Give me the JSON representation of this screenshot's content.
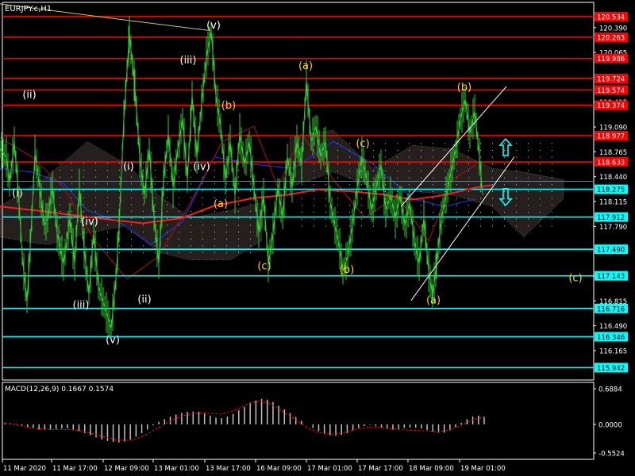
{
  "title": "EURJPY.c,H1",
  "chart_data": [
    {
      "type": "line",
      "name": "price",
      "title": "EURJPY.c,H1",
      "ylim": [
        115.78,
        120.72
      ],
      "x_labels": [
        "11 Mar 2020",
        "11 Mar 17:00",
        "12 Mar 09:00",
        "13 Mar 01:00",
        "13 Mar 17:00",
        "16 Mar 09:00",
        "17 Mar 01:00",
        "17 Mar 17:00",
        "18 Mar 09:00",
        "19 Mar 01:00"
      ],
      "y_ticks": [
        120.39,
        120.065,
        119.74,
        119.415,
        119.09,
        118.765,
        118.44,
        118.115,
        117.79,
        117.465,
        117.14,
        116.815,
        116.49,
        116.165
      ],
      "price_path": [
        [
          0,
          118.8
        ],
        [
          8,
          118.7
        ],
        [
          12,
          118.35
        ],
        [
          18,
          118.9
        ],
        [
          24,
          118.1
        ],
        [
          28,
          117.4
        ],
        [
          34,
          116.8
        ],
        [
          40,
          117.9
        ],
        [
          44,
          118.75
        ],
        [
          50,
          118.3
        ],
        [
          56,
          117.8
        ],
        [
          60,
          117.9
        ],
        [
          66,
          118.3
        ],
        [
          72,
          117.7
        ],
        [
          80,
          117.3
        ],
        [
          88,
          117.9
        ],
        [
          94,
          117.3
        ],
        [
          100,
          118.3
        ],
        [
          106,
          117.5
        ],
        [
          112,
          116.9
        ],
        [
          118,
          117.7
        ],
        [
          124,
          117.0
        ],
        [
          130,
          116.8
        ],
        [
          136,
          116.6
        ],
        [
          140,
          116.45
        ],
        [
          146,
          117.1
        ],
        [
          150,
          117.8
        ],
        [
          156,
          119.2
        ],
        [
          163,
          120.3
        ],
        [
          170,
          119.6
        ],
        [
          176,
          118.7
        ],
        [
          182,
          118.2
        ],
        [
          188,
          118.8
        ],
        [
          194,
          117.9
        ],
        [
          200,
          117.3
        ],
        [
          206,
          118.4
        ],
        [
          212,
          119.0
        ],
        [
          218,
          118.3
        ],
        [
          224,
          118.8
        ],
        [
          230,
          119.2
        ],
        [
          236,
          118.4
        ],
        [
          242,
          119.5
        ],
        [
          248,
          118.7
        ],
        [
          254,
          119.4
        ],
        [
          260,
          120.0
        ],
        [
          266,
          120.35
        ],
        [
          272,
          119.5
        ],
        [
          278,
          119.1
        ],
        [
          284,
          118.4
        ],
        [
          290,
          118.9
        ],
        [
          296,
          118.2
        ],
        [
          302,
          119.0
        ],
        [
          308,
          118.6
        ],
        [
          314,
          118.9
        ],
        [
          320,
          118.3
        ],
        [
          326,
          117.7
        ],
        [
          332,
          118.2
        ],
        [
          338,
          117.3
        ],
        [
          344,
          117.7
        ],
        [
          350,
          118.3
        ],
        [
          356,
          117.9
        ],
        [
          362,
          118.7
        ],
        [
          368,
          118.3
        ],
        [
          374,
          118.9
        ],
        [
          380,
          118.6
        ],
        [
          386,
          119.7
        ],
        [
          392,
          118.9
        ],
        [
          398,
          119.1
        ],
        [
          404,
          118.7
        ],
        [
          410,
          118.9
        ],
        [
          416,
          118.1
        ],
        [
          422,
          117.8
        ],
        [
          428,
          117.5
        ],
        [
          432,
          117.2
        ],
        [
          438,
          117.4
        ],
        [
          444,
          117.8
        ],
        [
          450,
          118.3
        ],
        [
          456,
          118.7
        ],
        [
          462,
          118.4
        ],
        [
          468,
          118.0
        ],
        [
          474,
          118.3
        ],
        [
          480,
          118.6
        ],
        [
          486,
          118.0
        ],
        [
          492,
          118.2
        ],
        [
          498,
          117.9
        ],
        [
          504,
          118.2
        ],
        [
          510,
          117.8
        ],
        [
          516,
          118.1
        ],
        [
          522,
          117.6
        ],
        [
          528,
          117.3
        ],
        [
          534,
          117.9
        ],
        [
          540,
          117.2
        ],
        [
          545,
          116.88
        ],
        [
          550,
          117.3
        ],
        [
          556,
          117.9
        ],
        [
          562,
          118.2
        ],
        [
          568,
          118.5
        ],
        [
          574,
          118.8
        ],
        [
          580,
          119.2
        ],
        [
          586,
          119.45
        ],
        [
          592,
          119.0
        ],
        [
          598,
          119.3
        ],
        [
          604,
          118.7
        ],
        [
          608,
          118.2
        ]
      ],
      "levels_red": [
        120.534,
        120.263,
        119.986,
        119.724,
        119.574,
        119.374,
        118.977,
        118.633
      ],
      "levels_cyan": [
        118.275,
        117.912,
        117.49,
        117.143,
        116.716,
        116.346,
        115.942
      ],
      "price_current": 118.38,
      "wave_labels": [
        {
          "x": 37,
          "y": 119.47,
          "text": "(ii)",
          "color": "#FFFFFF"
        },
        {
          "x": 22,
          "y": 118.18,
          "text": "(i)",
          "color": "#FFFFFF"
        },
        {
          "x": 113,
          "y": 117.81,
          "text": "(iv)",
          "color": "#FFFFFF"
        },
        {
          "x": 102,
          "y": 116.72,
          "text": "(iii)",
          "color": "#FFFFFF"
        },
        {
          "x": 182,
          "y": 116.79,
          "text": "(ii)",
          "color": "#FFFFFF"
        },
        {
          "x": 142,
          "y": 116.26,
          "text": "(v)",
          "color": "#FFFFFF"
        },
        {
          "x": 162,
          "y": 118.53,
          "text": "(i)",
          "color": "#FFFFFF"
        },
        {
          "x": 237,
          "y": 119.92,
          "text": "(iii)",
          "color": "#FFFFFF"
        },
        {
          "x": 254,
          "y": 118.53,
          "text": "(iv)",
          "color": "#FFFFFF"
        },
        {
          "x": 269,
          "y": 120.38,
          "text": "(v)",
          "color": "#FFFFFF"
        },
        {
          "x": 288,
          "y": 119.33,
          "text": "(b)",
          "color": "#FFD700"
        },
        {
          "x": 278,
          "y": 118.04,
          "text": "(a)",
          "color": "#FFD700"
        },
        {
          "x": 333,
          "y": 117.23,
          "text": "(c)",
          "color": "#FFD700"
        },
        {
          "x": 385,
          "y": 119.85,
          "text": "(a)",
          "color": "#FFD700"
        },
        {
          "x": 437,
          "y": 117.18,
          "text": "(b)",
          "color": "#FFD700"
        },
        {
          "x": 457,
          "y": 118.83,
          "text": "(c)",
          "color": "#FFD700"
        },
        {
          "x": 585,
          "y": 119.57,
          "text": "(b)",
          "color": "#FFD700"
        },
        {
          "x": 546,
          "y": 116.78,
          "text": "(a)",
          "color": "#FFD700"
        },
        {
          "x": 725,
          "y": 117.07,
          "text": "(c)",
          "color": "#FFD700"
        }
      ],
      "ma_red_path": [
        [
          0,
          118.05
        ],
        [
          60,
          117.98
        ],
        [
          120,
          117.9
        ],
        [
          180,
          117.83
        ],
        [
          230,
          117.9
        ],
        [
          270,
          118.06
        ],
        [
          320,
          118.16
        ],
        [
          360,
          118.2
        ],
        [
          400,
          118.27
        ],
        [
          440,
          118.25
        ],
        [
          480,
          118.21
        ],
        [
          520,
          118.14
        ],
        [
          560,
          118.2
        ],
        [
          600,
          118.3
        ],
        [
          620,
          118.33
        ]
      ],
      "trend_yellow_path": [
        [
          0,
          120.7
        ],
        [
          150,
          120.5
        ],
        [
          265,
          120.35
        ]
      ],
      "channel_lines": [
        {
          "x1": 518,
          "y1": 116.82,
          "x2": 648,
          "y2": 118.7
        },
        {
          "x1": 505,
          "y1": 118.05,
          "x2": 638,
          "y2": 119.62
        }
      ],
      "arrows": [
        {
          "x": 637,
          "y": 118.82,
          "dir": "up",
          "color": "#00FFFF"
        },
        {
          "x": 637,
          "y": 118.18,
          "dir": "down",
          "color": "#00FFFF"
        }
      ]
    },
    {
      "type": "bar",
      "name": "macd",
      "title": "MACD(12,26,9) 0.1667 0.1574",
      "ylim": [
        -0.5524,
        0.6884
      ],
      "y_ticks": [
        0.6884,
        0.0,
        -0.5524
      ],
      "values": [
        0.02,
        0.02,
        0.01,
        -0.02,
        -0.05,
        -0.08,
        -0.1,
        -0.11,
        -0.1,
        -0.09,
        -0.08,
        -0.08,
        -0.1,
        -0.13,
        -0.17,
        -0.21,
        -0.25,
        -0.29,
        -0.32,
        -0.34,
        -0.35,
        -0.33,
        -0.29,
        -0.24,
        -0.17,
        -0.1,
        -0.02,
        0.05,
        0.1,
        0.15,
        0.19,
        0.22,
        0.24,
        0.25,
        0.24,
        0.21,
        0.17,
        0.13,
        0.12,
        0.15,
        0.2,
        0.27,
        0.34,
        0.41,
        0.46,
        0.49,
        0.48,
        0.43,
        0.36,
        0.29,
        0.22,
        0.14,
        0.07,
        0.0,
        -0.07,
        -0.13,
        -0.18,
        -0.21,
        -0.22,
        -0.2,
        -0.17,
        -0.12,
        -0.07,
        -0.03,
        -0.01,
        -0.03,
        -0.06,
        -0.09,
        -0.1,
        -0.09,
        -0.07,
        -0.06,
        -0.06,
        -0.08,
        -0.11,
        -0.14,
        -0.16,
        -0.16,
        -0.12,
        -0.05,
        0.03,
        0.1,
        0.15,
        0.17,
        0.14
      ],
      "signal": [
        0.03,
        0.0,
        -0.04,
        -0.07,
        -0.09,
        -0.1,
        -0.1,
        -0.1,
        -0.12,
        -0.16,
        -0.21,
        -0.26,
        -0.3,
        -0.31,
        -0.28,
        -0.2,
        -0.1,
        0.0,
        0.1,
        0.17,
        0.21,
        0.22,
        0.21,
        0.2,
        0.24,
        0.32,
        0.41,
        0.45,
        0.42,
        0.32,
        0.2,
        0.08,
        -0.04,
        -0.13,
        -0.18,
        -0.19,
        -0.16,
        -0.11,
        -0.07,
        -0.05,
        -0.06,
        -0.08,
        -0.1,
        -0.11,
        -0.12,
        -0.13,
        -0.14,
        -0.12,
        -0.06,
        0.02,
        0.1,
        0.15
      ]
    }
  ],
  "colors": {
    "background": "#000000",
    "frame": "#FFFFFF",
    "price": "#32CD32",
    "red_levels": "#FF0000",
    "cyan_levels": "#00FFFF",
    "ma": "#FF1A1A",
    "yellow_trend": "#C8C864",
    "channel": "#FFFFFF",
    "macd_hist": "#C0C0C0",
    "macd_signal": "#FF0000",
    "cloud": "#E6C8B4",
    "text": "#FFFFFF",
    "current_price_tag": "#708090"
  }
}
